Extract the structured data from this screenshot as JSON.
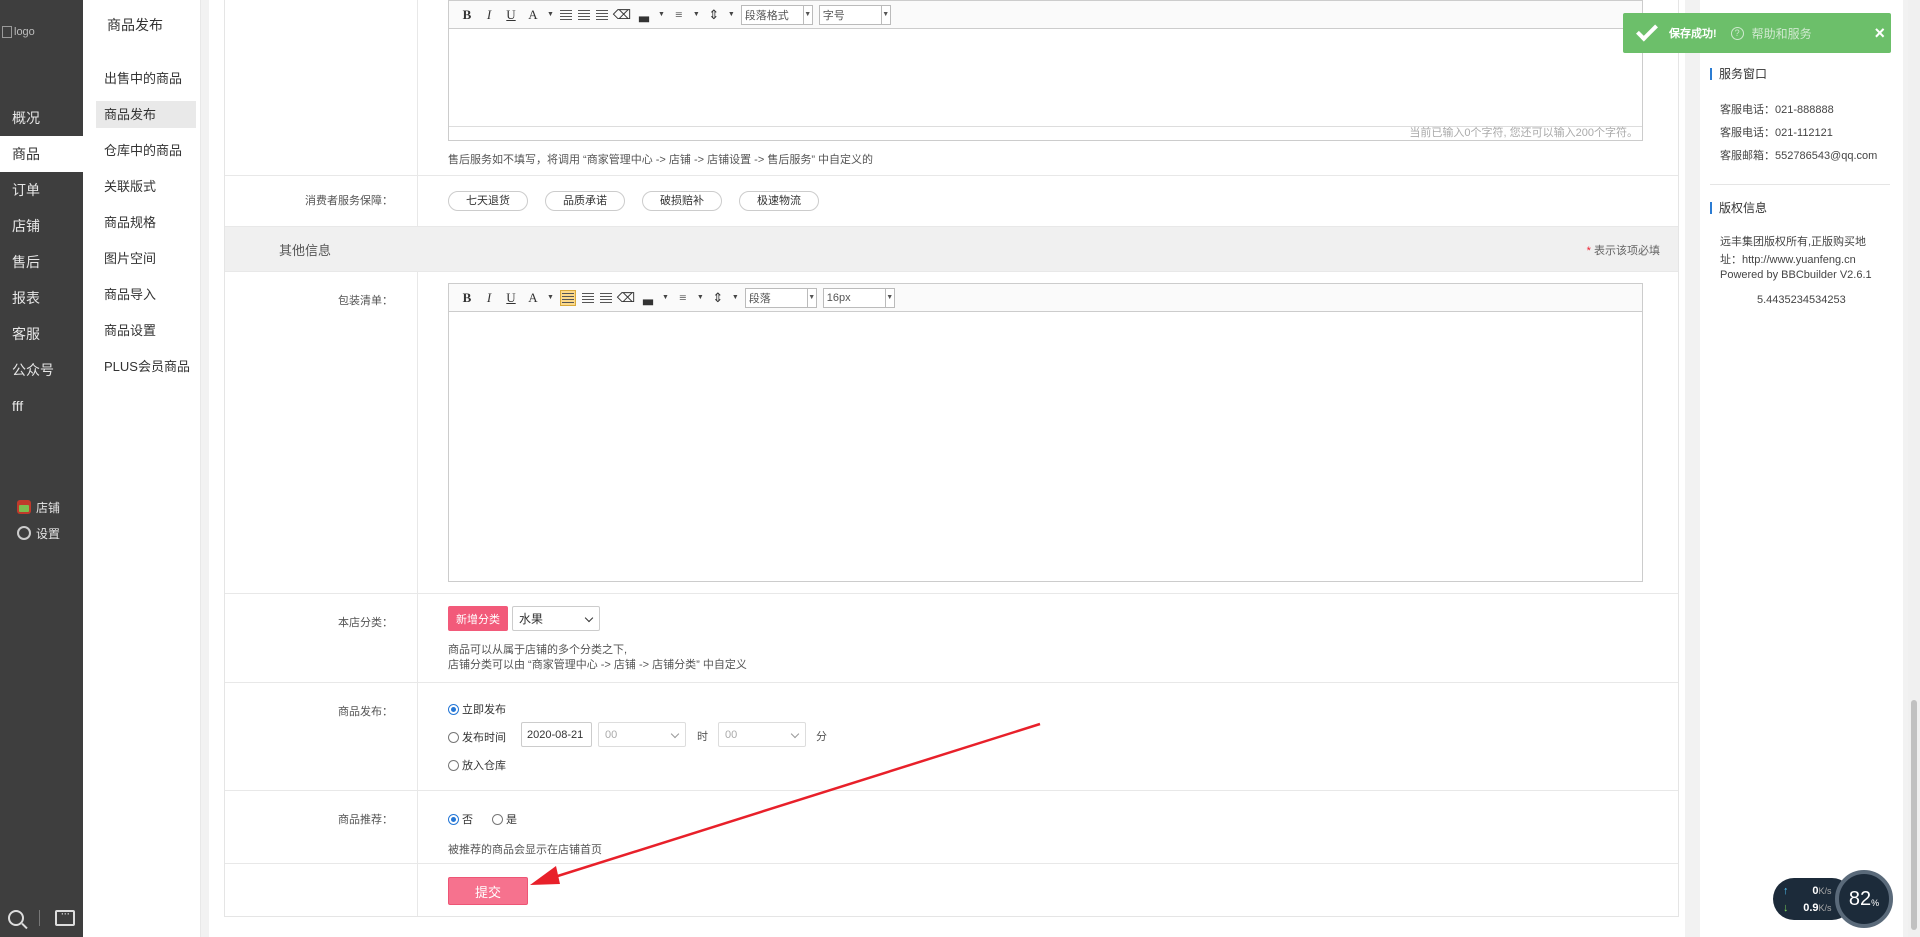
{
  "sidebar": {
    "logo_alt": "logo",
    "items": [
      "概况",
      "商品",
      "订单",
      "店铺",
      "售后",
      "报表",
      "客服",
      "公众号",
      "fff"
    ],
    "active_index": 1,
    "tools": [
      "店铺",
      "设置"
    ]
  },
  "subnav": {
    "title": "商品发布",
    "items": [
      "出售中的商品",
      "商品发布",
      "仓库中的商品",
      "关联版式",
      "商品规格",
      "图片空间",
      "商品导入",
      "商品设置",
      "PLUS会员商品"
    ],
    "active_index": 1
  },
  "editor1": {
    "format_select": "段落格式",
    "size_select": "字号",
    "counter": "当前已输入0个字符, 您还可以输入200个字符。"
  },
  "after_sales_note": "售后服务如不填写，将调用 “商家管理中心 -> 店铺 -> 店铺设置 -> 售后服务” 中自定义的",
  "guarantee": {
    "label": "消费者服务保障：",
    "tags": [
      "七天退货",
      "品质承诺",
      "破损赔补",
      "极速物流"
    ]
  },
  "other_section": {
    "title": "其他信息",
    "required_note": "表示该项必填",
    "required_star": "*"
  },
  "packing": {
    "label": "包装清单：",
    "format_select": "段落",
    "size_select": "16px"
  },
  "shop_category": {
    "label": "本店分类：",
    "add_button": "新增分类",
    "selected": "水果",
    "note1": "商品可以从属于店铺的多个分类之下,",
    "note2": "店铺分类可以由 “商家管理中心 -> 店铺 -> 店铺分类” 中自定义"
  },
  "publish": {
    "label": "商品发布：",
    "options": [
      "立即发布",
      "发布时间",
      "放入仓库"
    ],
    "selected_index": 0,
    "date": "2020-08-21",
    "hour": "00",
    "hour_unit": "时",
    "minute": "00",
    "minute_unit": "分"
  },
  "recommend": {
    "label": "商品推荐：",
    "options": [
      "否",
      "是"
    ],
    "selected_index": 0,
    "note": "被推荐的商品会显示在店铺首页"
  },
  "submit_label": "提交",
  "right_panel": {
    "service_title": "服务窗口",
    "service_lines": [
      "客服电话：021-888888",
      "客服电话：021-112121",
      "客服邮箱：552786543@qq.com"
    ],
    "copyright_title": "版权信息",
    "copyright_lines": [
      "远丰集团版权所有,正版购买地",
      "址：http://www.yuanfeng.cn",
      "Powered by BBCbuilder V2.6.1"
    ],
    "version": "5.4435234534253"
  },
  "toast": {
    "message": "保存成功!",
    "help": "帮助和服务",
    "close": "×"
  },
  "speed": {
    "up": "0",
    "down": "0.9",
    "unit": "K/s",
    "percent": "82",
    "percent_sign": "%"
  },
  "colors": {
    "accent_pink": "#f25a7a",
    "toast_green": "#6cbf6a",
    "sidebar_dark": "#3e3e3e",
    "annotation_red": "#e8202a"
  }
}
